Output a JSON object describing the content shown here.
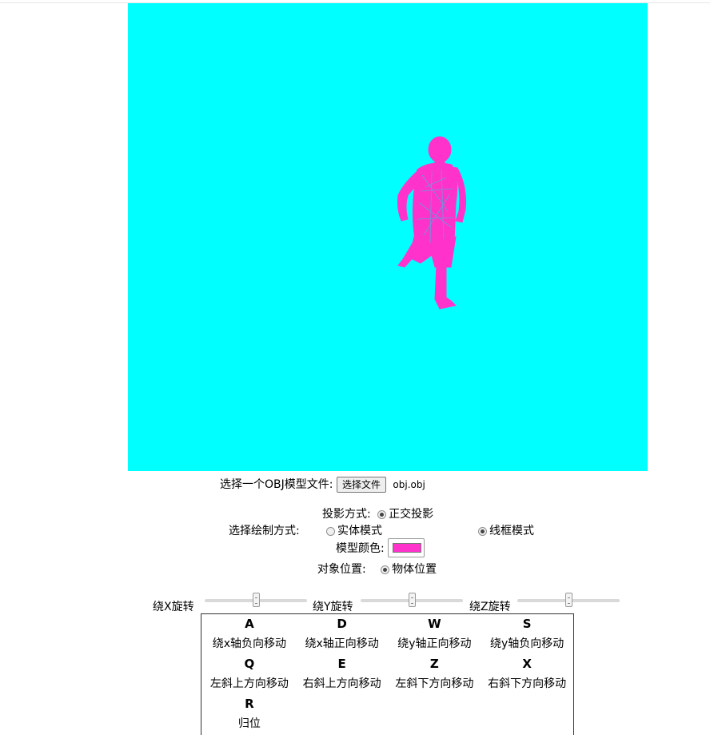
{
  "colors": {
    "canvas_bg": "#00ffff",
    "model": "#ff33cc"
  },
  "file": {
    "label": "选择一个OBJ模型文件:",
    "button": "选择文件",
    "filename": "obj.obj"
  },
  "projection": {
    "label": "投影方式:",
    "option": "正交投影",
    "selected": true
  },
  "draw_mode": {
    "label": "选择绘制方式:",
    "solid": "实体模式",
    "wireframe": "线框模式",
    "selected": "线框模式"
  },
  "model_color": {
    "label": "模型颜色:",
    "value": "#ff33cc"
  },
  "object_position": {
    "label": "对象位置:",
    "option": "物体位置",
    "selected": true
  },
  "sliders": [
    {
      "label": "绕X旋转",
      "value": 0.5
    },
    {
      "label": "绕Y旋转",
      "value": 0.5
    },
    {
      "label": "绕Z旋转",
      "value": 0.5
    }
  ],
  "keys": {
    "r1": [
      "A",
      "D",
      "W",
      "S"
    ],
    "r2": [
      "绕x轴负向移动",
      "绕x轴正向移动",
      "绕y轴正向移动",
      "绕y轴负向移动"
    ],
    "r3": [
      "Q",
      "E",
      "Z",
      "X"
    ],
    "r4": [
      "左斜上方向移动",
      "右斜上方向移动",
      "左斜下方向移动",
      "右斜下方向移动"
    ],
    "r5": [
      "R"
    ],
    "r6": [
      "归位"
    ]
  }
}
